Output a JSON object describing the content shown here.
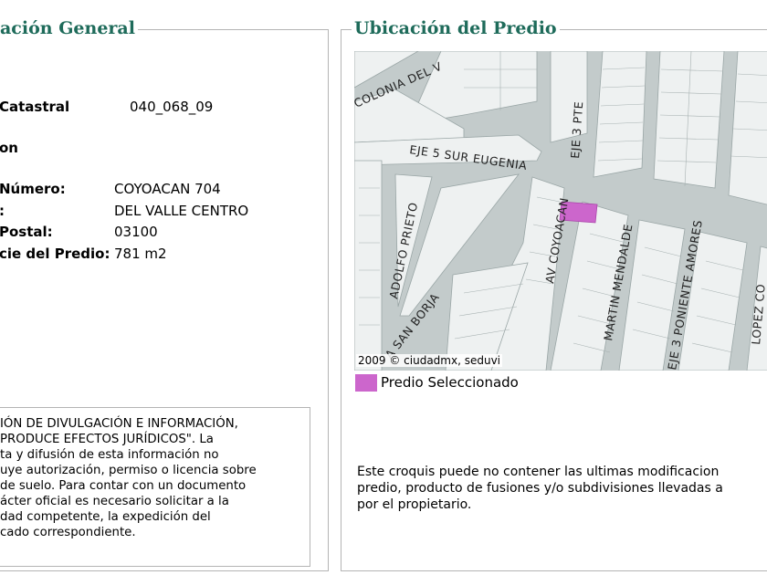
{
  "left_panel": {
    "title": "ación General",
    "cuenta_label": "Catastral",
    "cuenta_value": "040_068_09",
    "section_label": "on",
    "rows": [
      {
        "label": "Número:",
        "value": "COYOACAN 704"
      },
      {
        "label": ":",
        "value": "DEL VALLE CENTRO"
      },
      {
        "label": "Postal:",
        "value": "03100"
      },
      {
        "label": "cie del Predio:",
        "value": "781 m2"
      }
    ],
    "notice_lines": [
      "IÓN DE DIVULGACIÓN E INFORMACIÓN,",
      "PRODUCE EFECTOS JURÍDICOS\". La",
      "ta y difusión de esta información no",
      "uye autorización, permiso o licencia sobre",
      "de suelo. Para contar con un documento",
      "ácter oficial es necesario solicitar a la",
      "dad competente, la expedición del",
      "cado correspondiente."
    ]
  },
  "right_panel": {
    "title": "Ubicación del Predio",
    "map": {
      "streets": {
        "colonia": "COLONIA DEL V",
        "eje5": "EJE 5 SUR EUGENIA",
        "eje3pte": "EJE 3 PTE",
        "coyoacan": "AV COYOACAN",
        "adolfo": "ADOLFO PRIETO",
        "sanborja": "A SAN BORJA",
        "mendalde": "MARTIN MENDALDE",
        "amores": "EJE 3 PONIENTE AMORES",
        "lopez": "LOPEZ CO"
      },
      "copyright": "2009 © ciudadmx, seduvi",
      "selected_color": "#cc66cc"
    },
    "legend_label": "Predio Seleccionado",
    "croquis_lines": [
      "Este croquis puede no contener las ultimas modificacion",
      "predio, producto de fusiones y/o subdivisiones llevadas a",
      "por el propietario."
    ]
  }
}
